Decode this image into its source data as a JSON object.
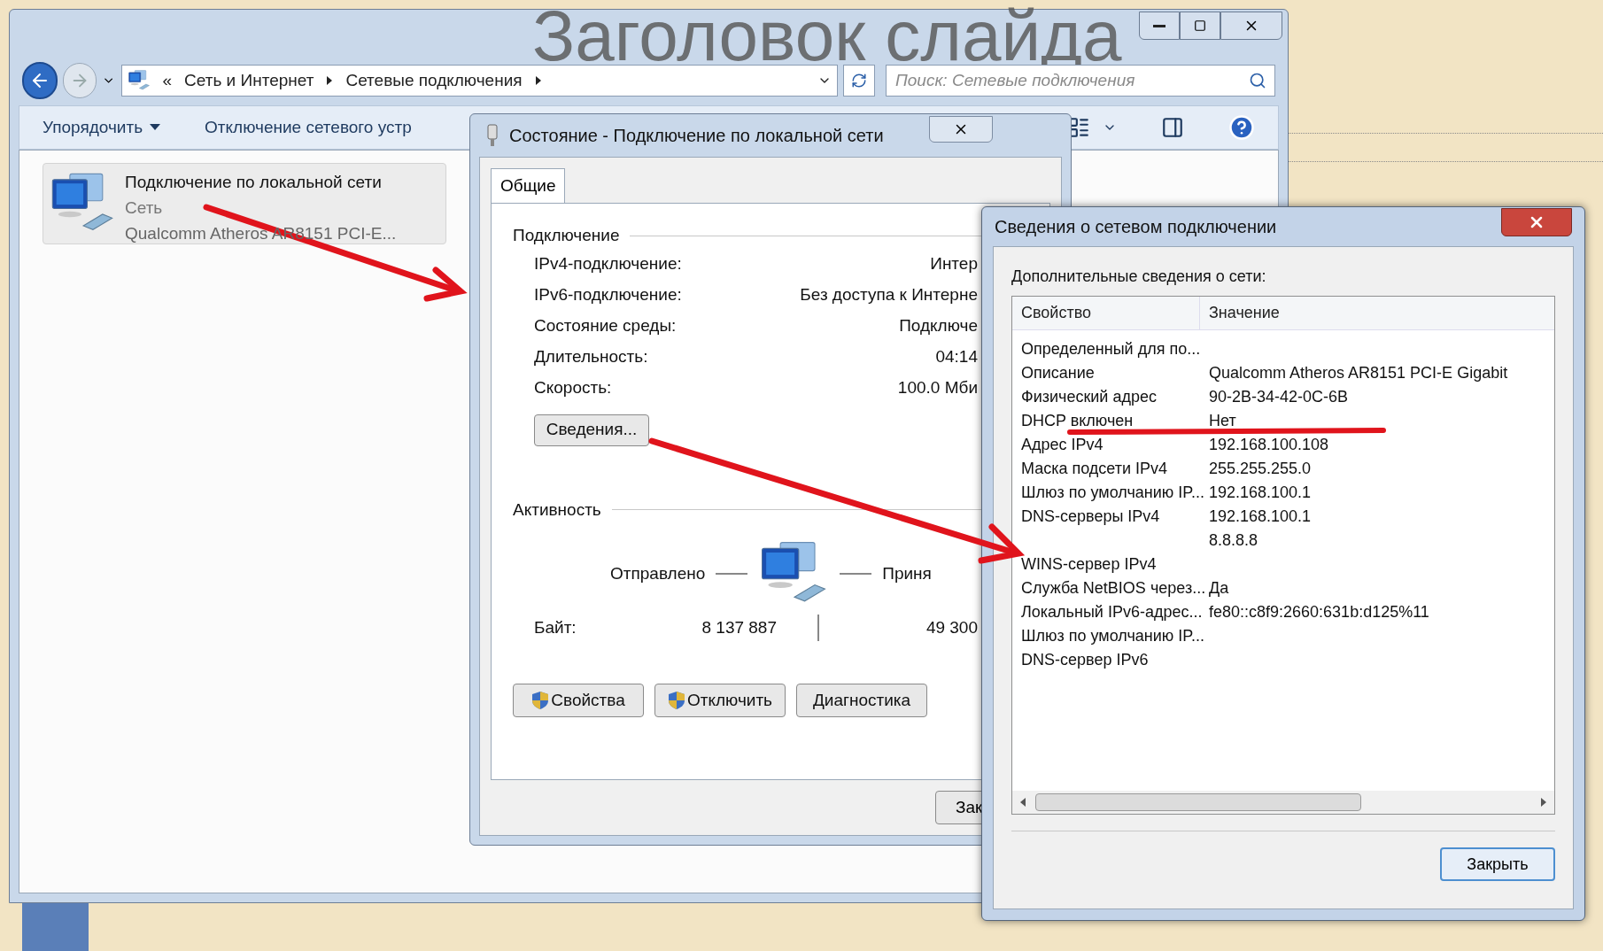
{
  "slide": {
    "title": "Заголовок слайда"
  },
  "explorer": {
    "overflow": "«",
    "breadcrumb": [
      {
        "label": "Сеть и Интернет"
      },
      {
        "label": "Сетевые подключения"
      }
    ],
    "search": {
      "placeholder": "Поиск: Сетевые подключения"
    },
    "toolbar": [
      {
        "label": "Упорядочить",
        "dropdown": true
      },
      {
        "label": "Отключение сетевого устр",
        "dropdown": false
      }
    ],
    "items": [
      {
        "name": "Подключение по локальной сети",
        "status": "Сеть",
        "device": "Qualcomm Atheros AR8151 PCI-E...",
        "selected": true
      }
    ]
  },
  "status_dialog": {
    "title": "Состояние - Подключение по локальной сети",
    "tabs": [
      {
        "label": "Общие",
        "selected": true
      }
    ],
    "connection": {
      "heading": "Подключение",
      "rows": [
        {
          "label": "IPv4-подключение:",
          "value": "Интер"
        },
        {
          "label": "IPv6-подключение:",
          "value": "Без доступа к Интерне"
        },
        {
          "label": "Состояние среды:",
          "value": "Подключе"
        },
        {
          "label": "Длительность:",
          "value": "04:14"
        },
        {
          "label": "Скорость:",
          "value": "100.0 Мби"
        }
      ]
    },
    "details_button": "Сведения...",
    "activity": {
      "heading": "Активность",
      "sent": "Отправлено",
      "received": "Приня",
      "bytes_label": "Байт:",
      "bytes_sent": "8 137 887",
      "bytes_received": "49 300"
    },
    "buttons": [
      {
        "label": "Свойства",
        "shield": true
      },
      {
        "label": "Отключить",
        "shield": true
      },
      {
        "label": "Диагностика",
        "shield": false
      }
    ],
    "close_button": "Зак"
  },
  "details_dialog": {
    "title": "Сведения о сетевом подключении",
    "caption": "Дополнительные сведения о сети:",
    "columns": [
      "Свойство",
      "Значение"
    ],
    "rows": [
      {
        "property": "Определенный для по..."
      },
      {
        "property": "Описание",
        "value": "Qualcomm Atheros AR8151 PCI-E Gigabit"
      },
      {
        "property": "Физический адрес",
        "value": "90-2B-34-42-0C-6B"
      },
      {
        "property": "DHCP включен",
        "value": "Нет"
      },
      {
        "property": "Адрес IPv4",
        "value": "192.168.100.108"
      },
      {
        "property": "Маска подсети IPv4",
        "value": "255.255.255.0"
      },
      {
        "property": "Шлюз по умолчанию IP...",
        "value": "192.168.100.1"
      },
      {
        "property": "DNS-серверы IPv4",
        "value": "192.168.100.1"
      },
      {
        "value": "8.8.8.8"
      },
      {
        "property": "WINS-сервер IPv4"
      },
      {
        "property": "Служба NetBIOS через...",
        "value": "Да"
      },
      {
        "property": "Локальный IPv6-адрес...",
        "value": "fe80::c8f9:2660:631b:d125%11"
      },
      {
        "property": "Шлюз по умолчанию IP..."
      },
      {
        "property": "DNS-сервер IPv6"
      }
    ],
    "close_button": "Закрыть"
  }
}
